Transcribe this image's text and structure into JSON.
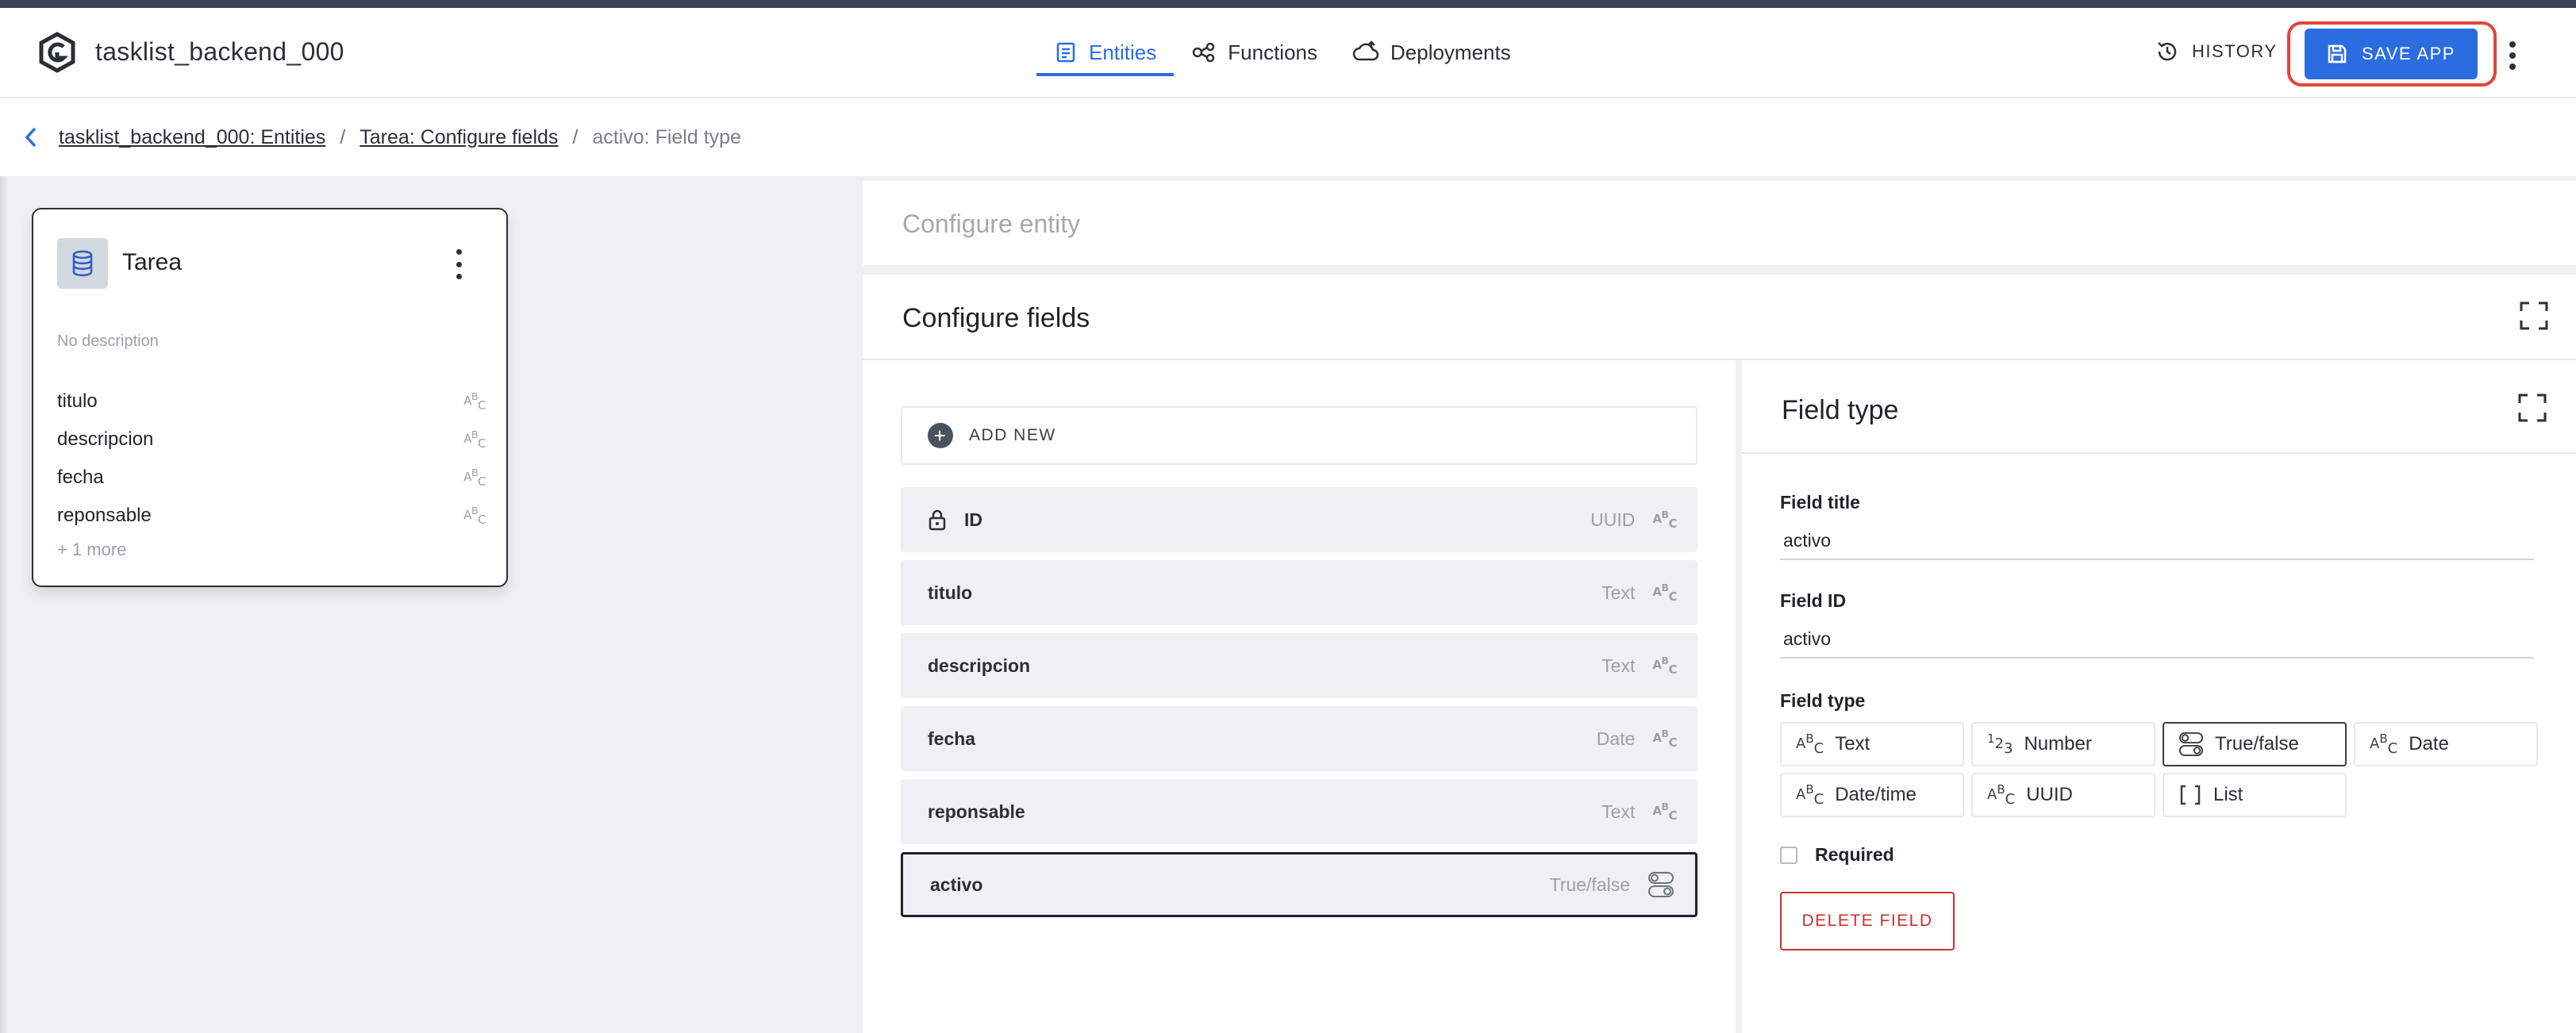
{
  "app": {
    "title": "tasklist_backend_000"
  },
  "nav": {
    "tabs": [
      {
        "label": "Entities",
        "icon": "entities-icon",
        "active": true
      },
      {
        "label": "Functions",
        "icon": "functions-icon",
        "active": false
      },
      {
        "label": "Deployments",
        "icon": "cloud-upload-icon",
        "active": false
      }
    ]
  },
  "header": {
    "history_label": "HISTORY",
    "save_label": "SAVE APP"
  },
  "breadcrumb": {
    "items": [
      "tasklist_backend_000: Entities",
      "Tarea: Configure fields"
    ],
    "current": "activo: Field type"
  },
  "entity_card": {
    "name": "Tarea",
    "description": "No description",
    "fields": [
      "titulo",
      "descripcion",
      "fecha",
      "reponsable"
    ],
    "more": "+ 1 more",
    "type_glyph": "ABC"
  },
  "config_entity": {
    "title": "Configure entity"
  },
  "config_fields": {
    "title": "Configure fields",
    "add_new_label": "ADD NEW",
    "rows": [
      {
        "name": "ID",
        "type": "UUID",
        "icon": "abc-icon",
        "locked": true
      },
      {
        "name": "titulo",
        "type": "Text",
        "icon": "abc-icon"
      },
      {
        "name": "descripcion",
        "type": "Text",
        "icon": "abc-icon"
      },
      {
        "name": "fecha",
        "type": "Date",
        "icon": "abc-icon"
      },
      {
        "name": "reponsable",
        "type": "Text",
        "icon": "abc-icon"
      },
      {
        "name": "activo",
        "type": "True/false",
        "icon": "toggle-icon",
        "selected": true
      }
    ]
  },
  "field_type_panel": {
    "title": "Field type",
    "field_title_label": "Field title",
    "field_title_value": "activo",
    "field_id_label": "Field ID",
    "field_id_value": "activo",
    "field_type_label": "Field type",
    "options": [
      {
        "label": "Text",
        "icon": "abc-icon"
      },
      {
        "label": "Number",
        "icon": "number-icon"
      },
      {
        "label": "True/false",
        "icon": "toggle-icon",
        "selected": true
      },
      {
        "label": "Date",
        "icon": "abc-icon"
      },
      {
        "label": "Date/time",
        "icon": "abc-icon"
      },
      {
        "label": "UUID",
        "icon": "abc-icon"
      },
      {
        "label": "List",
        "icon": "list-icon"
      }
    ],
    "required_label": "Required",
    "required_checked": false,
    "delete_label": "DELETE FIELD"
  },
  "colors": {
    "accent": "#2b6de0",
    "danger": "#c9302c",
    "highlight_ring": "#e0453a"
  }
}
